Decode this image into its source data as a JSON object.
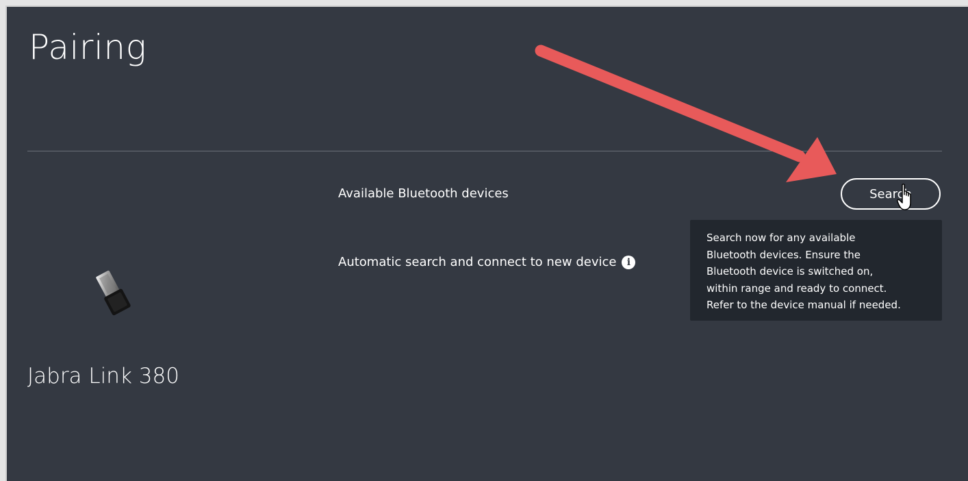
{
  "page": {
    "title": "Pairing"
  },
  "device": {
    "name": "Jabra Link 380",
    "image_icon": "usb-dongle-icon"
  },
  "settings": {
    "bluetooth_label": "Available Bluetooth devices",
    "search_button_label": "Search",
    "auto_connect_label": "Automatic search and connect to new device",
    "info_icon": "i"
  },
  "tooltip": {
    "lines": [
      "Search now for any available",
      "Bluetooth devices. Ensure the",
      "Bluetooth device is switched on,",
      "within range and ready to connect.",
      "Refer to the device manual if needed."
    ]
  },
  "annotation": {
    "arrow_color": "#e85a5a"
  },
  "colors": {
    "background": "#343942",
    "tooltip_background": "#22272e",
    "text": "#ffffff"
  }
}
